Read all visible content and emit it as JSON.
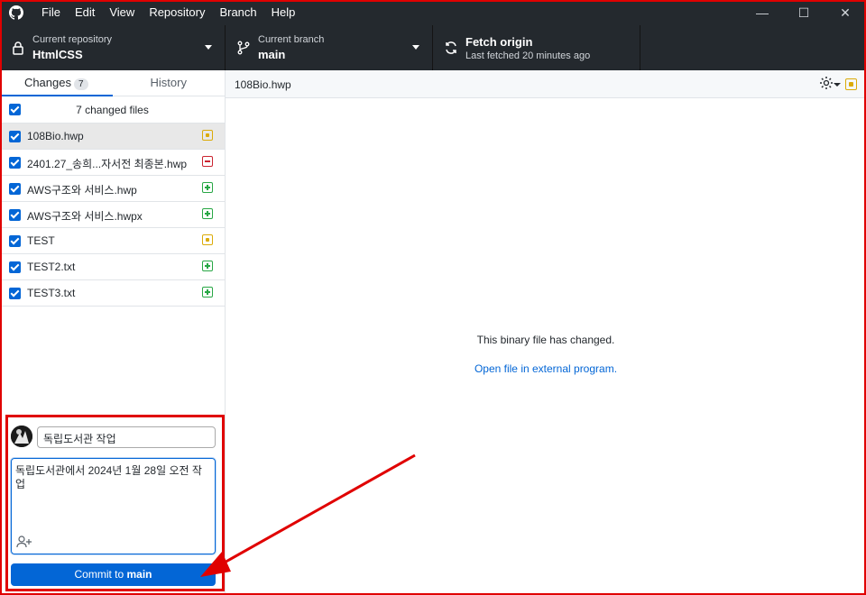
{
  "menu": [
    "File",
    "Edit",
    "View",
    "Repository",
    "Branch",
    "Help"
  ],
  "window_controls": {
    "minimize": "—",
    "maximize": "☐",
    "close": "✕"
  },
  "toolbar": {
    "repo_label": "Current repository",
    "repo_value": "HtmlCSS",
    "branch_label": "Current branch",
    "branch_value": "main",
    "fetch_title": "Fetch origin",
    "fetch_sub": "Last fetched 20 minutes ago"
  },
  "tabs": {
    "changes": "Changes",
    "changes_count": "7",
    "history": "History"
  },
  "changed_header": "7 changed files",
  "files": [
    {
      "name": "108Bio.hwp",
      "status": "modified"
    },
    {
      "name": "2401.27_송희...자서전 최종본.hwp",
      "status": "deleted"
    },
    {
      "name": "AWS구조와 서비스.hwp",
      "status": "added"
    },
    {
      "name": "AWS구조와 서비스.hwpx",
      "status": "added"
    },
    {
      "name": "TEST",
      "status": "modified"
    },
    {
      "name": "TEST2.txt",
      "status": "added"
    },
    {
      "name": "TEST3.txt",
      "status": "added"
    }
  ],
  "commit": {
    "summary": "독립도서관 작업",
    "description": "독립도서관에서 2024년 1월 28일 오전 작업",
    "button_prefix": "Commit to ",
    "button_branch": "main"
  },
  "main": {
    "path": "108Bio.hwp",
    "binary_message": "This binary file has changed.",
    "open_link": "Open file in external program."
  },
  "colors": {
    "accent": "#0366d6",
    "annotation": "#e00000",
    "modified": "#dbab09",
    "added": "#28a745",
    "deleted": "#cb2431"
  }
}
